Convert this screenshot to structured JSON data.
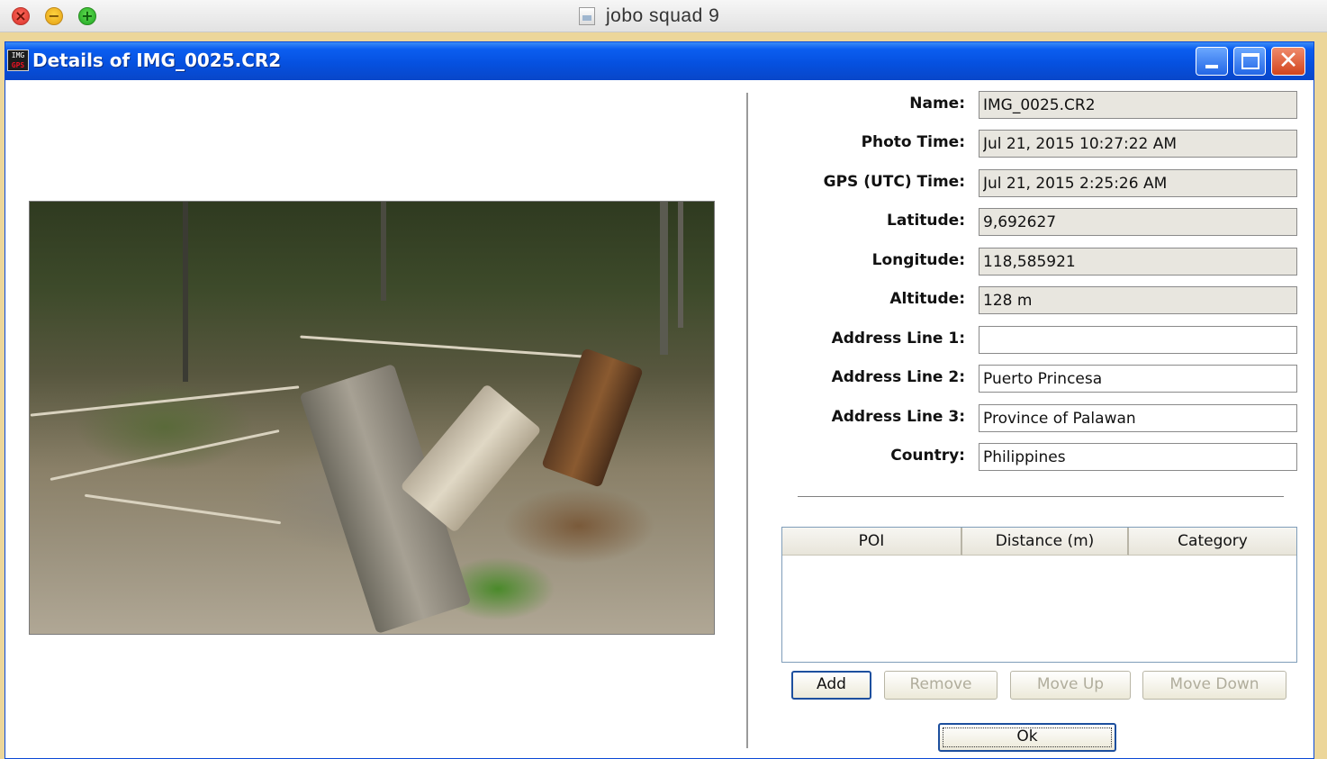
{
  "host_window": {
    "title": "jobo squad 9",
    "buttons": [
      "close",
      "minimize",
      "zoom"
    ]
  },
  "dialog": {
    "title": "Details of IMG_0025.CR2",
    "icon_text": "IMG",
    "icon_text_2": "GPS"
  },
  "photo": {
    "alt": "forest clearing with fallen tree trunk"
  },
  "form": {
    "name": {
      "label": "Name:",
      "value": "IMG_0025.CR2"
    },
    "photo_time": {
      "label": "Photo Time:",
      "value": "Jul 21, 2015 10:27:22 AM"
    },
    "gps_time": {
      "label": "GPS (UTC) Time:",
      "value": "Jul 21, 2015 2:25:26 AM"
    },
    "latitude": {
      "label": "Latitude:",
      "value": "9,692627"
    },
    "longitude": {
      "label": "Longitude:",
      "value": "118,585921"
    },
    "altitude": {
      "label": "Altitude:",
      "value": "128 m"
    },
    "address_line_1": {
      "label": "Address Line 1:",
      "value": ""
    },
    "address_line_2": {
      "label": "Address Line 2:",
      "value": "Puerto Princesa"
    },
    "address_line_3": {
      "label": "Address Line 3:",
      "value": "Province of Palawan"
    },
    "country": {
      "label": "Country:",
      "value": "Philippines"
    }
  },
  "poi_table": {
    "columns": [
      "POI",
      "Distance (m)",
      "Category"
    ],
    "rows": []
  },
  "buttons": {
    "add": "Add",
    "remove": "Remove",
    "move_up": "Move Up",
    "move_down": "Move Down",
    "ok": "Ok"
  },
  "colors": {
    "dialog_titlebar": "#0651e0",
    "readonly_field": "#e8e6df",
    "desktop": "#ecd69a"
  }
}
